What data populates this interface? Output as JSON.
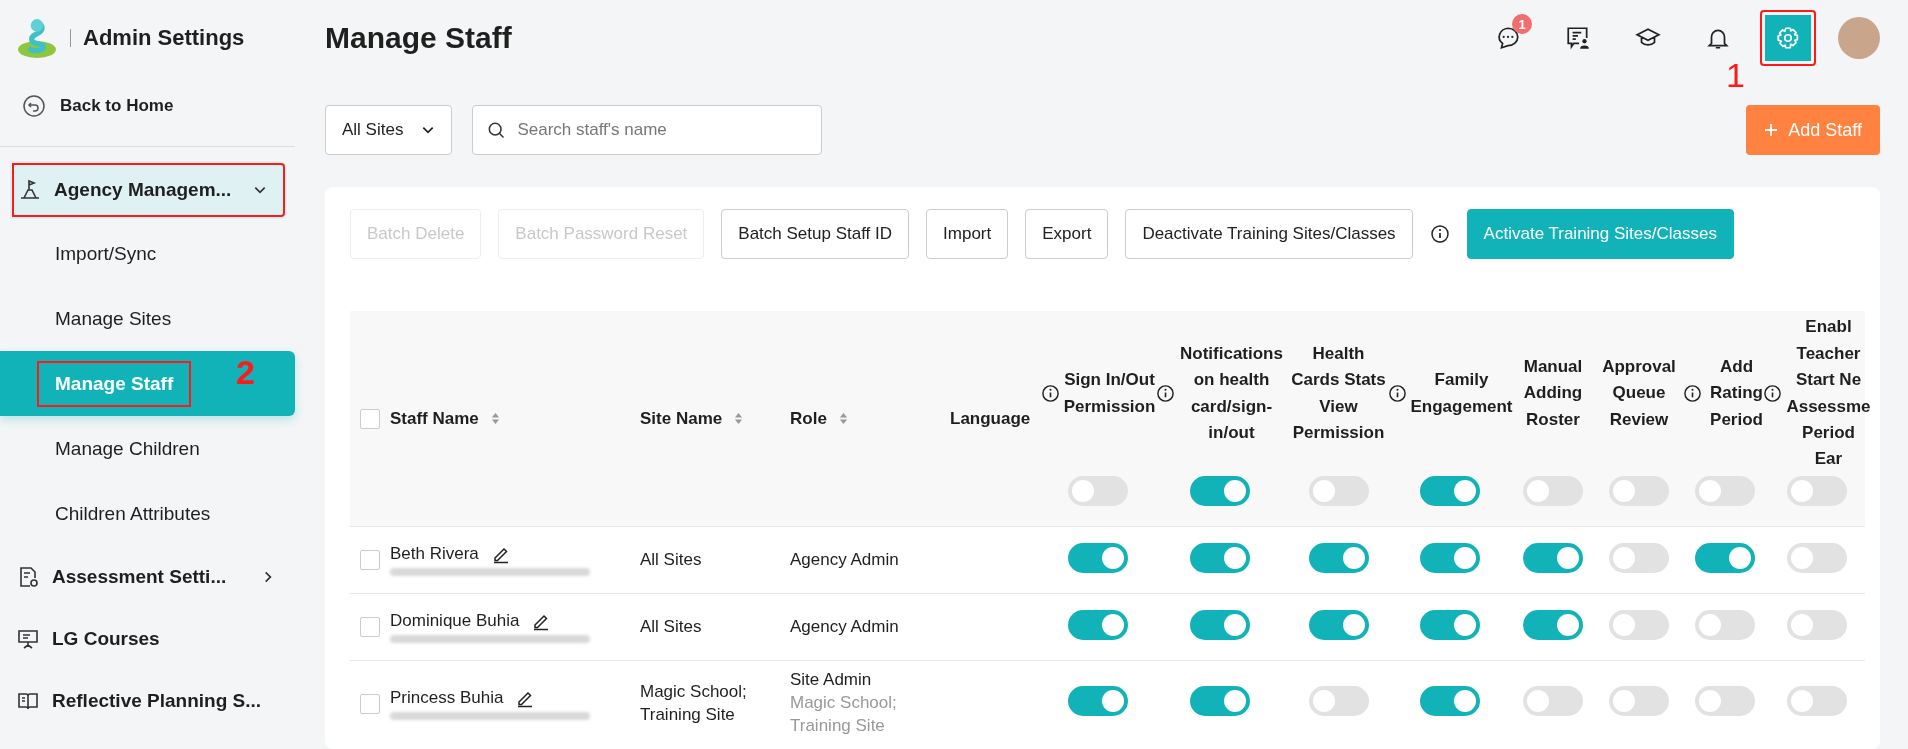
{
  "sidebar": {
    "app_title": "Admin Settings",
    "back_link": "Back to Home",
    "items": [
      {
        "kind": "group",
        "label": "Agency Managem...",
        "expanded": true,
        "annotated": true,
        "children": [
          {
            "label": "Import/Sync",
            "selected": false,
            "annotated": false
          },
          {
            "label": "Manage Sites",
            "selected": false,
            "annotated": false
          },
          {
            "label": "Manage Staff",
            "selected": true,
            "annotated": true,
            "annotation_label": "2"
          },
          {
            "label": "Manage Children",
            "selected": false,
            "annotated": false
          },
          {
            "label": "Children Attributes",
            "selected": false,
            "annotated": false
          }
        ]
      },
      {
        "kind": "group",
        "label": "Assessment Setti...",
        "expanded": false,
        "annotated": false
      },
      {
        "kind": "link",
        "label": "LG Courses",
        "annotated": false
      },
      {
        "kind": "link",
        "label": "Reflective Planning S...",
        "annotated": false
      }
    ]
  },
  "header": {
    "title": "Manage Staff",
    "icons": [
      {
        "kind": "chat",
        "badge": "1",
        "selected": false,
        "annotated": false
      },
      {
        "kind": "board-person",
        "selected": false,
        "annotated": false
      },
      {
        "kind": "cap",
        "selected": false,
        "annotated": false
      },
      {
        "kind": "bell",
        "selected": false,
        "annotated": false
      },
      {
        "kind": "gear",
        "selected": true,
        "annotated": true,
        "annotation_label": "1"
      }
    ]
  },
  "filters": {
    "site_select": "All Sites",
    "search": {
      "placeholder": "Search staff's name"
    },
    "add_button": "Add Staff"
  },
  "toolbar": [
    {
      "kind": "button",
      "label": "Batch Delete",
      "disabled": true
    },
    {
      "kind": "button",
      "label": "Batch Password Reset",
      "disabled": true
    },
    {
      "kind": "button",
      "label": "Batch Setup Staff ID",
      "disabled": false
    },
    {
      "kind": "button",
      "label": "Import",
      "disabled": false
    },
    {
      "kind": "button",
      "label": "Export",
      "disabled": false
    },
    {
      "kind": "button",
      "label": "Deactivate Training Sites/Classes",
      "disabled": false
    },
    {
      "kind": "info"
    },
    {
      "kind": "primary",
      "label": "Activate Training Sites/Classes",
      "disabled": false
    }
  ],
  "table": {
    "select_all": {
      "checked": false
    },
    "columns": [
      {
        "label": "Staff Name",
        "sortable": true
      },
      {
        "label": "Site Name",
        "sortable": true
      },
      {
        "label": "Role",
        "sortable": true
      },
      {
        "label": "Language",
        "sortable": false
      }
    ],
    "toggle_columns": [
      {
        "label": "Sign In/Out Permission",
        "info": true,
        "on": false
      },
      {
        "label": "Notifications on health card/sign-in/out",
        "info": true,
        "on": true
      },
      {
        "label": "Health Cards Stats View Permission",
        "info": false,
        "on": false
      },
      {
        "label": "Family Engagement",
        "info": true,
        "on": true
      },
      {
        "label": "Manual Adding Roster",
        "info": false,
        "on": false
      },
      {
        "label": "Approval Queue Review",
        "info": false,
        "on": false
      },
      {
        "label": "Add Rating Period",
        "info": true,
        "on": false
      },
      {
        "label": "Enabl Teacher Start Ne Assessme Period Ear",
        "info": true,
        "on": false
      }
    ],
    "rows": [
      {
        "checked": false,
        "name": "Beth Rivera",
        "site": "All Sites",
        "role": "Agency Admin",
        "toggles": [
          true,
          true,
          true,
          true,
          true,
          false,
          true,
          false
        ]
      },
      {
        "checked": false,
        "name": "Dominique Buhia",
        "site": "All Sites",
        "role": "Agency Admin",
        "toggles": [
          true,
          true,
          true,
          true,
          true,
          false,
          false,
          false
        ]
      },
      {
        "checked": false,
        "name": "Princess Buhia",
        "site": "Magic School; Training Site",
        "role": "Site Admin",
        "role_detail": "Magic School; Training Site",
        "toggles": [
          true,
          true,
          false,
          true,
          false,
          false,
          false,
          false
        ]
      }
    ]
  }
}
